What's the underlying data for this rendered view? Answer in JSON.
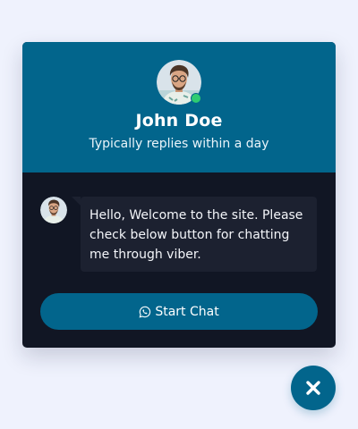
{
  "agent": {
    "name": "John Doe",
    "subtitle": "Typically replies within a day",
    "status": "online"
  },
  "message": {
    "text": "Hello, Welcome to the site. Please check below button for chatting me through viber."
  },
  "start_chat": {
    "label": "Start Chat",
    "icon": "whatsapp-icon"
  },
  "close_button": {
    "icon": "close-icon"
  },
  "colors": {
    "page_bg": "#eff2fd",
    "primary": "#02658c",
    "panel_bg": "#111624",
    "bubble_bg": "#1c2130",
    "online": "#2ecc71"
  }
}
